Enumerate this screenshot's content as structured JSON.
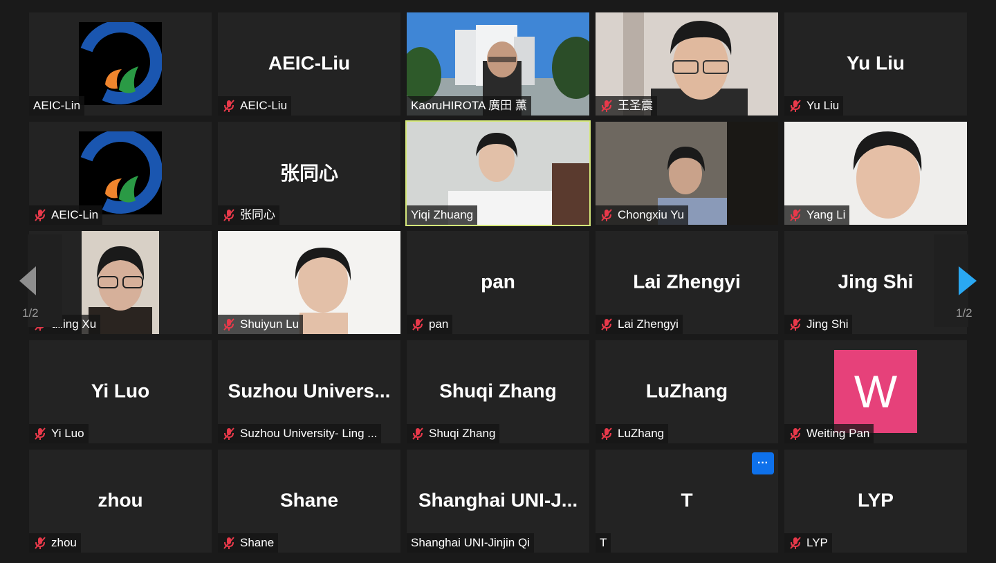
{
  "page_indicator": "1/2",
  "colors": {
    "active_border": "#d5e87a",
    "avatar_w": "#e6417a",
    "more_button": "#0e71eb",
    "nav_arrow_right": "#2aa8f2"
  },
  "tiles": [
    {
      "label": "AEIC-Lin",
      "muted": false,
      "kind": "logo"
    },
    {
      "label": "AEIC-Liu",
      "big": "AEIC-Liu",
      "muted": true,
      "kind": "name"
    },
    {
      "label": "KaoruHIROTA 廣田 薫",
      "muted": false,
      "kind": "video"
    },
    {
      "label": "王圣震",
      "muted": true,
      "kind": "video"
    },
    {
      "label": "Yu Liu",
      "big": "Yu Liu",
      "muted": true,
      "kind": "name"
    },
    {
      "label": "AEIC-Lin",
      "muted": true,
      "kind": "logo"
    },
    {
      "label": "张同心",
      "big": "张同心",
      "muted": true,
      "kind": "name"
    },
    {
      "label": "Yiqi Zhuang",
      "muted": false,
      "kind": "video",
      "active": true
    },
    {
      "label": "Chongxiu Yu",
      "muted": true,
      "kind": "video"
    },
    {
      "label": "Yang Li",
      "muted": true,
      "kind": "video"
    },
    {
      "label": "uiling Xu",
      "muted": true,
      "kind": "video"
    },
    {
      "label": "Shuiyun Lu",
      "muted": true,
      "kind": "video"
    },
    {
      "label": "pan",
      "big": "pan",
      "muted": true,
      "kind": "name"
    },
    {
      "label": "Lai Zhengyi",
      "big": "Lai Zhengyi",
      "muted": true,
      "kind": "name"
    },
    {
      "label": "Jing Shi",
      "big": "Jing Shi",
      "muted": true,
      "kind": "name"
    },
    {
      "label": "Yi Luo",
      "big": "Yi Luo",
      "muted": true,
      "kind": "name"
    },
    {
      "label": "Suzhou University- Ling ...",
      "big": "Suzhou  Univers...",
      "muted": true,
      "kind": "name"
    },
    {
      "label": "Shuqi Zhang",
      "big": "Shuqi Zhang",
      "muted": true,
      "kind": "name"
    },
    {
      "label": "LuZhang",
      "big": "LuZhang",
      "muted": true,
      "kind": "name"
    },
    {
      "label": "Weiting Pan",
      "avatar": "W",
      "muted": true,
      "kind": "avatar"
    },
    {
      "label": "zhou",
      "big": "zhou",
      "muted": true,
      "kind": "name"
    },
    {
      "label": "Shane",
      "big": "Shane",
      "muted": true,
      "kind": "name"
    },
    {
      "label": "Shanghai UNI-Jinjin Qi",
      "big": "Shanghai  UNI-J...",
      "muted": false,
      "kind": "name"
    },
    {
      "label": "T",
      "big": "T",
      "muted": false,
      "kind": "name",
      "more": "···"
    },
    {
      "label": "LYP",
      "big": "LYP",
      "muted": true,
      "kind": "name"
    }
  ]
}
